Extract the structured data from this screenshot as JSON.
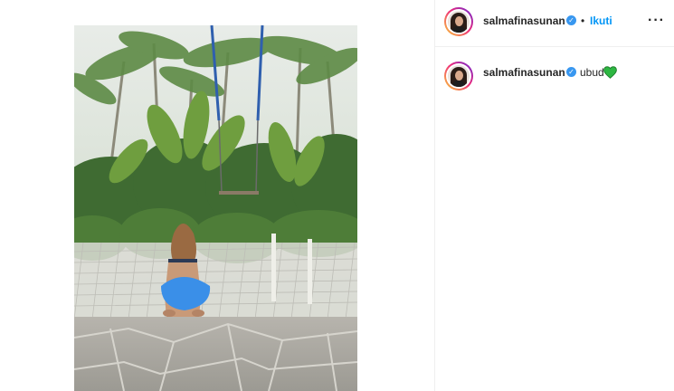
{
  "post": {
    "username": "salmafinasunan",
    "separator": "•",
    "follow_label": "Ikuti",
    "more_label": "···",
    "verified_mark": "✓"
  },
  "caption": {
    "username": "salmafinasunan",
    "text": "ubud",
    "emoji_icon": "green-heart-icon"
  },
  "colors": {
    "accent": "#0095f6",
    "verified": "#3897f0",
    "emoji_heart": "#2db742"
  }
}
